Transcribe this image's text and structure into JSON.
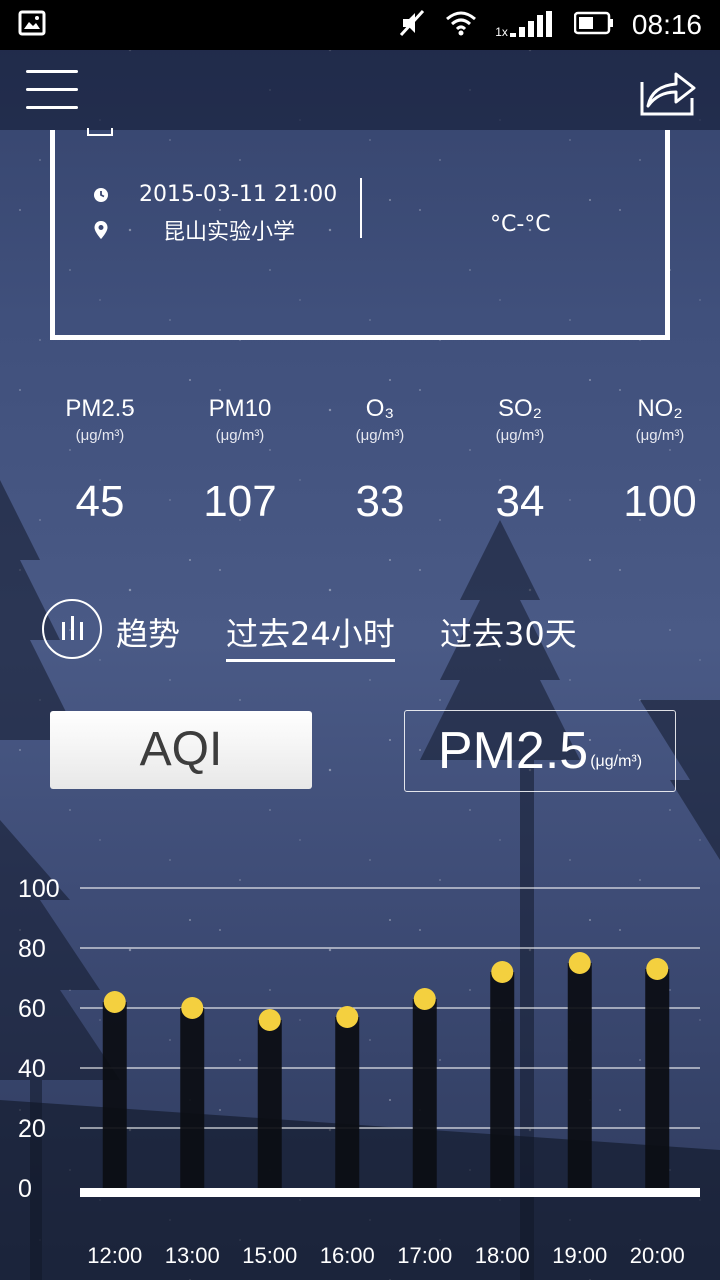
{
  "status_bar": {
    "time": "08:16",
    "network_label": "1x",
    "icons": [
      "image-icon",
      "mute-icon",
      "wifi-icon",
      "signal-icon",
      "battery-icon"
    ]
  },
  "app_bar": {
    "icons": [
      "menu-icon",
      "share-icon"
    ]
  },
  "station": {
    "datetime": "2015-03-11 21:00",
    "location": "昆山实验小学",
    "temperature": "°C-°C",
    "icons": [
      "clock-icon",
      "location-pin-icon"
    ]
  },
  "pollutants": [
    {
      "name": "PM2.5",
      "unit": "(μg/m³)",
      "value": "45"
    },
    {
      "name": "PM10",
      "unit": "(μg/m³)",
      "value": "107"
    },
    {
      "name": "O₃",
      "unit": "(μg/m³)",
      "value": "33"
    },
    {
      "name": "SO₂",
      "unit": "(μg/m³)",
      "value": "34"
    },
    {
      "name": "NO₂",
      "unit": "(μg/m³)",
      "value": "100"
    }
  ],
  "trend": {
    "label": "趋势",
    "tabs": [
      {
        "label": "过去24小时",
        "active": true
      },
      {
        "label": "过去30天",
        "active": false
      }
    ]
  },
  "toggles": {
    "aqi": "AQI",
    "pm": "PM2.5",
    "pm_unit": "(μg/m³)"
  },
  "colors": {
    "bar": "#0b0d12",
    "dot": "#f4d03f",
    "axis": "#ffffff"
  },
  "chart_data": {
    "type": "bar",
    "categories": [
      "12:00",
      "13:00",
      "15:00",
      "16:00",
      "17:00",
      "18:00",
      "19:00",
      "20:00"
    ],
    "values": [
      62,
      60,
      56,
      57,
      63,
      72,
      75,
      73
    ],
    "ylim": [
      0,
      100
    ],
    "yticks": [
      "0",
      "20",
      "40",
      "60",
      "80",
      "100"
    ],
    "grid": true,
    "markers": "dot"
  }
}
